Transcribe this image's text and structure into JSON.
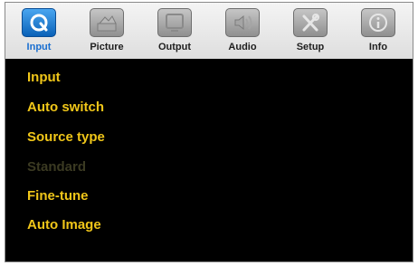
{
  "tabs": [
    {
      "label": "Input",
      "icon": "input-icon",
      "active": true
    },
    {
      "label": "Picture",
      "icon": "picture-icon",
      "active": false
    },
    {
      "label": "Output",
      "icon": "output-icon",
      "active": false
    },
    {
      "label": "Audio",
      "icon": "audio-icon",
      "active": false
    },
    {
      "label": "Setup",
      "icon": "setup-icon",
      "active": false
    },
    {
      "label": "Info",
      "icon": "info-icon",
      "active": false
    }
  ],
  "menu": {
    "items": [
      {
        "label": "Input",
        "enabled": true
      },
      {
        "label": "Auto switch",
        "enabled": true
      },
      {
        "label": "Source type",
        "enabled": true
      },
      {
        "label": "Standard",
        "enabled": false
      },
      {
        "label": "Fine-tune",
        "enabled": true
      },
      {
        "label": "Auto Image",
        "enabled": true
      }
    ]
  },
  "colors": {
    "menu_text": "#f0c619",
    "menu_text_disabled": "#3b3a22",
    "active_tab": "#1a6fd0",
    "background": "#000000"
  }
}
